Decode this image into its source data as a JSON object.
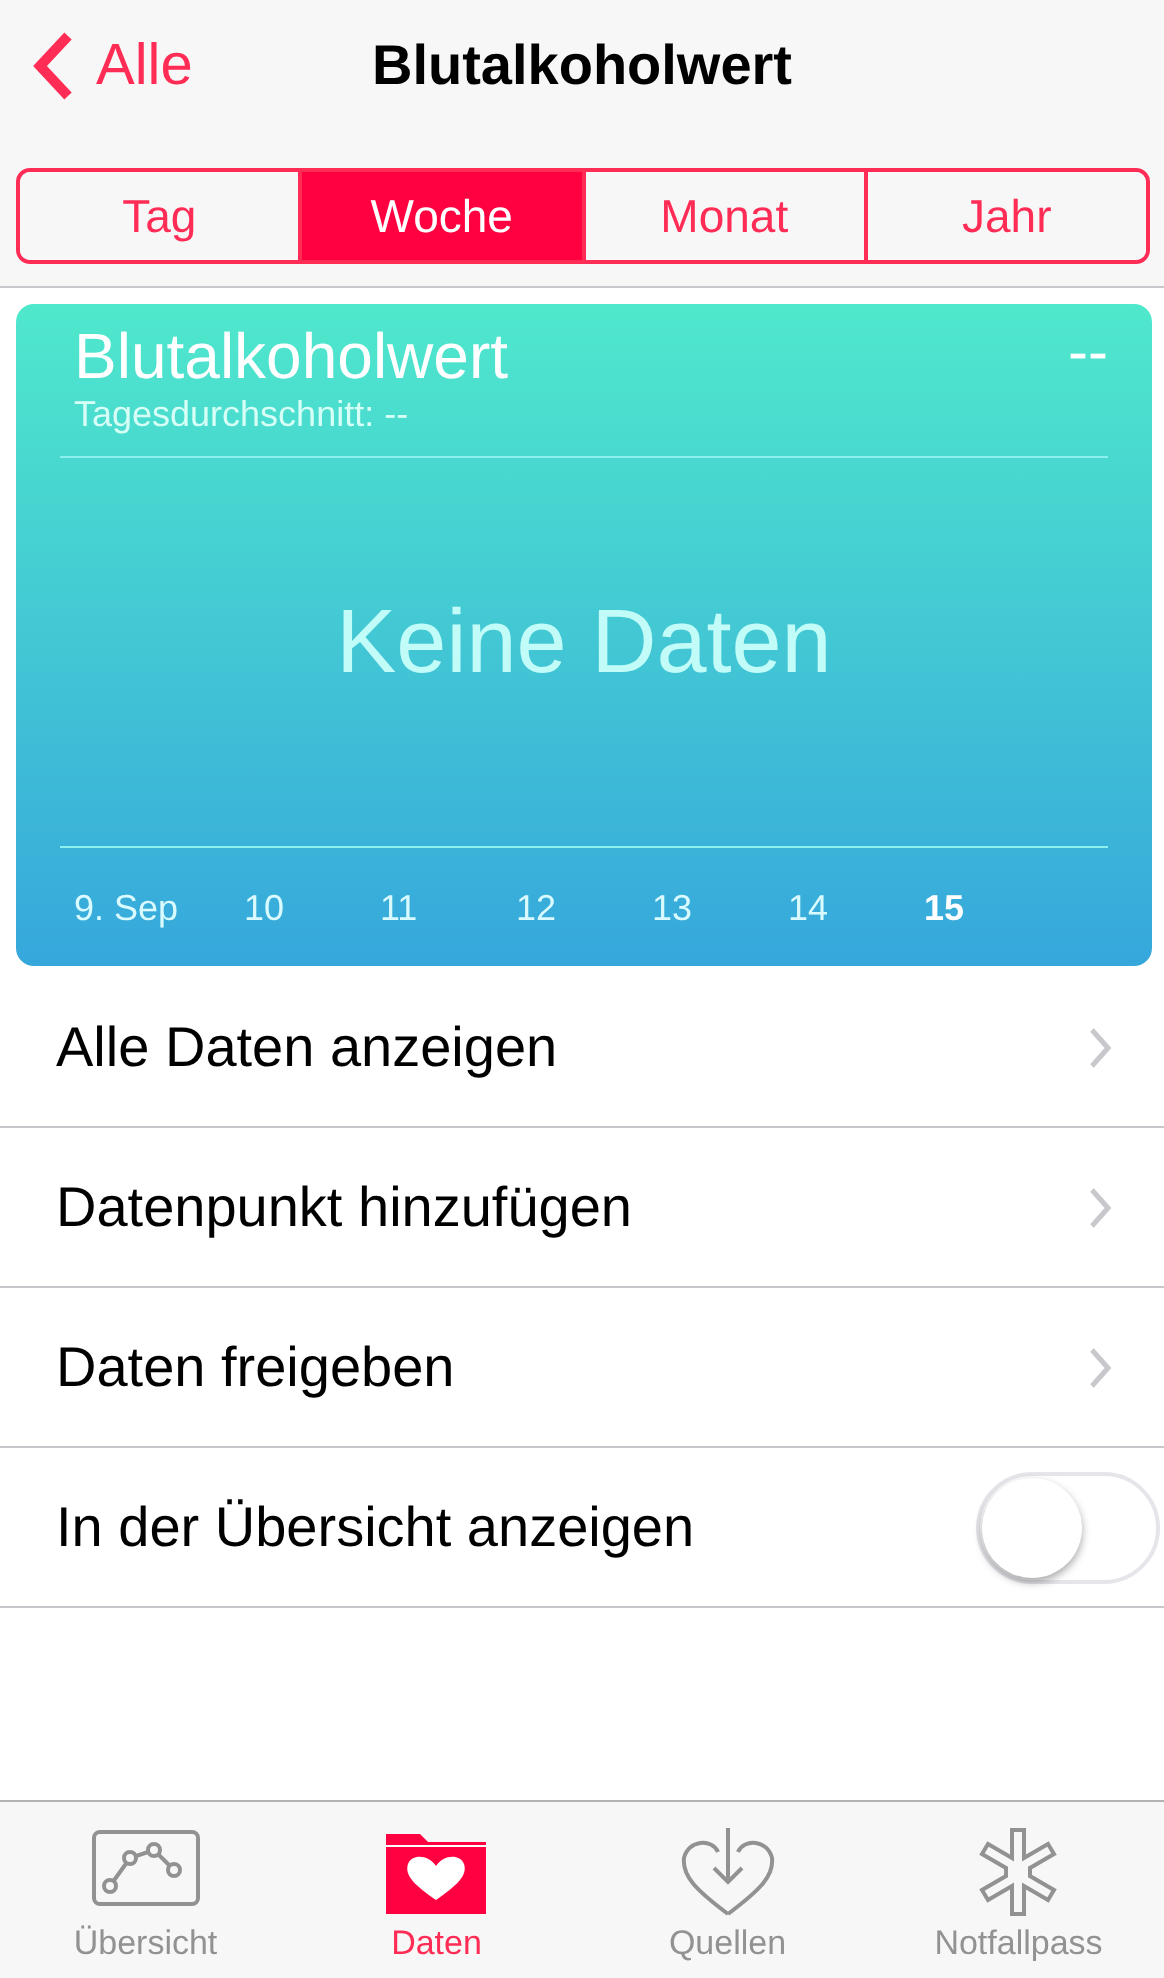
{
  "nav": {
    "back": "Alle",
    "title": "Blutalkoholwert"
  },
  "segments": [
    {
      "label": "Tag",
      "selected": false
    },
    {
      "label": "Woche",
      "selected": true
    },
    {
      "label": "Monat",
      "selected": false
    },
    {
      "label": "Jahr",
      "selected": false
    }
  ],
  "card": {
    "title": "Blutalkoholwert",
    "value": "--",
    "subtitle": "Tagesdurchschnitt: --",
    "empty": "Keine Daten",
    "days": [
      {
        "label": "9. Sep",
        "selected": false
      },
      {
        "label": "10",
        "selected": false
      },
      {
        "label": "11",
        "selected": false
      },
      {
        "label": "12",
        "selected": false
      },
      {
        "label": "13",
        "selected": false
      },
      {
        "label": "14",
        "selected": false
      },
      {
        "label": "15",
        "selected": true
      }
    ]
  },
  "rows": [
    {
      "kind": "link",
      "label": "Alle Daten anzeigen"
    },
    {
      "kind": "link",
      "label": "Datenpunkt hinzufügen"
    },
    {
      "kind": "link",
      "label": "Daten freigeben"
    },
    {
      "kind": "toggle",
      "label": "In der Übersicht anzeigen",
      "on": false
    }
  ],
  "tabbar": [
    {
      "label": "Übersicht",
      "selected": false
    },
    {
      "label": "Daten",
      "selected": true
    },
    {
      "label": "Quellen",
      "selected": false
    },
    {
      "label": "Notfallpass",
      "selected": false
    }
  ]
}
